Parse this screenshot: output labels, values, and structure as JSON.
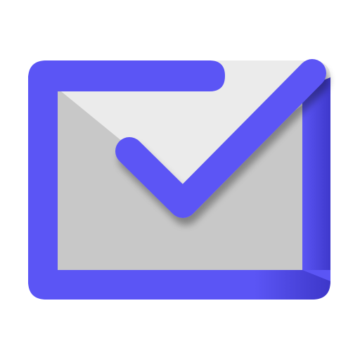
{
  "icon": {
    "name": "mail-check-icon",
    "colors": {
      "frame": "#5b55f5",
      "frame_dark": "#3d37c9",
      "frame_shadow": "#2f2aa8",
      "envelope_body": "#c8c8c8",
      "envelope_flap": "#ebebeb",
      "background": "#ffffff"
    }
  }
}
